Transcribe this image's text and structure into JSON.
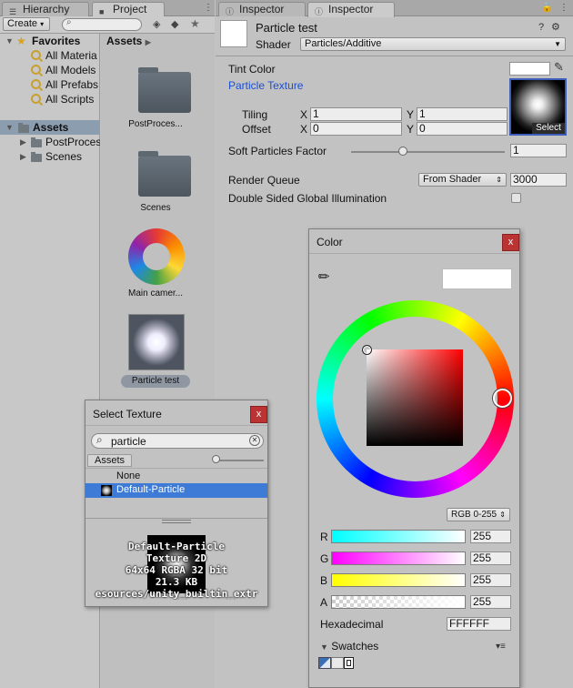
{
  "tabs_left": {
    "hierarchy": "Hierarchy",
    "project": "Project"
  },
  "tabs_right": {
    "inspector1": "Inspector",
    "inspector2": "Inspector"
  },
  "project": {
    "create_label": "Create",
    "favorites_label": "Favorites",
    "favorites": [
      "All Materia",
      "All Models",
      "All Prefabs",
      "All Scripts"
    ],
    "assets_label": "Assets",
    "tree": [
      "PostProces",
      "Scenes"
    ],
    "breadcrumb": "Assets",
    "items": [
      {
        "label": "PostProces...",
        "kind": "folder"
      },
      {
        "label": "Scenes",
        "kind": "folder"
      },
      {
        "label": "Main camer...",
        "kind": "profile"
      },
      {
        "label": "Particle test",
        "kind": "material",
        "selected": true
      }
    ]
  },
  "select_texture": {
    "title": "Select Texture",
    "search_value": "particle",
    "scope_tab": "Assets",
    "items": [
      {
        "label": "None",
        "selected": false
      },
      {
        "label": "Default-Particle",
        "selected": true
      }
    ],
    "preview_lines": [
      "Default-Particle",
      "Texture 2D",
      "64x64  RGBA 32 bit",
      "21.3 KB",
      "esources/unity_builtin_extr"
    ]
  },
  "inspector": {
    "material_name": "Particle test",
    "shader_label": "Shader",
    "shader_value": "Particles/Additive",
    "tint_color_label": "Tint Color",
    "particle_texture_label": "Particle Texture",
    "select_label": "Select",
    "tiling_label": "Tiling",
    "offset_label": "Offset",
    "tiling_x": "1",
    "tiling_y": "1",
    "offset_x": "0",
    "offset_y": "0",
    "x_label": "X",
    "y_label": "Y",
    "soft_particles_label": "Soft Particles Factor",
    "soft_particles_value": "1",
    "render_queue_label": "Render Queue",
    "render_queue_mode": "From Shader",
    "render_queue_value": "3000",
    "double_sided_label": "Double Sided Global Illumination"
  },
  "color_picker": {
    "title": "Color",
    "mode": "RGB 0-255",
    "r_label": "R",
    "r_value": "255",
    "g_label": "G",
    "g_value": "255",
    "b_label": "B",
    "b_value": "255",
    "a_label": "A",
    "a_value": "255",
    "hex_label": "Hexadecimal",
    "hex_value": "FFFFFF",
    "swatches_label": "Swatches"
  },
  "colors": {
    "accent_blue": "#3d7bd6",
    "link_blue": "#1a4fd6",
    "close_red": "#bb3333"
  }
}
